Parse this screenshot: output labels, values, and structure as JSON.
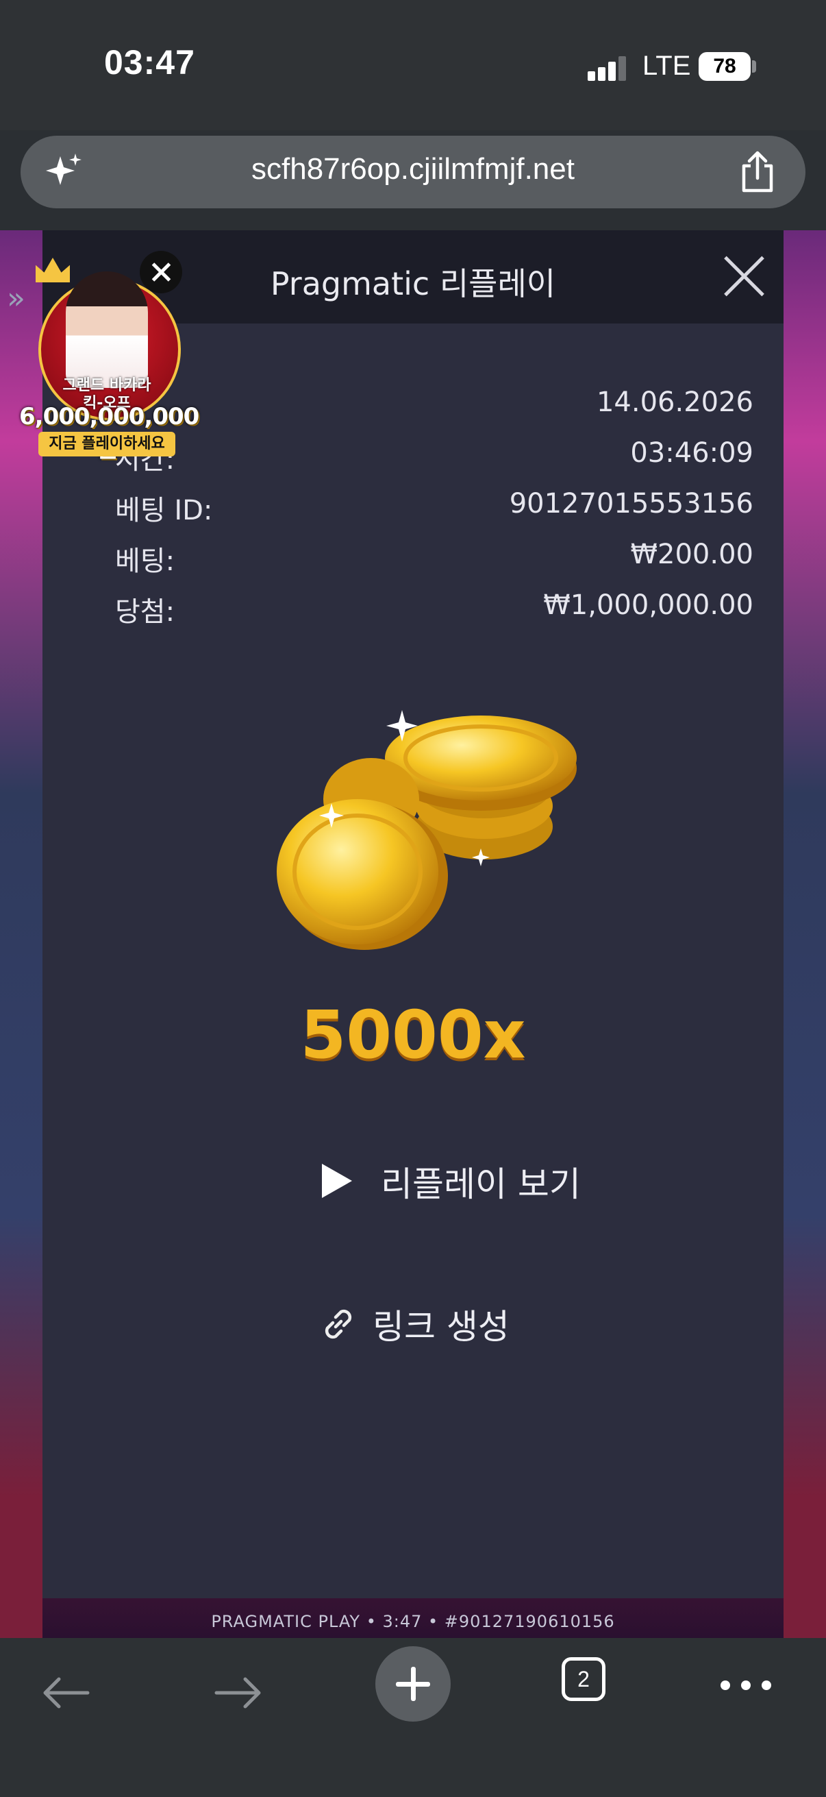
{
  "status_bar": {
    "time": "03:47",
    "network": "LTE",
    "battery": "78"
  },
  "browser": {
    "url": "scfh87r6op.cjiilmfmjf.net",
    "tab_count": "2"
  },
  "game": {
    "footer": "PRAGMATIC PLAY • 3:47 • #90127190610156"
  },
  "ad": {
    "line1": "그랜드 바카라",
    "line2": "킥-오프",
    "amount": "6,000,000,000원",
    "cta": "지금 플레이하세요"
  },
  "modal": {
    "title": "Pragmatic 리플레이",
    "rows": [
      {
        "label": "",
        "value": "14.06.2026"
      },
      {
        "label": "시간:",
        "value": "03:46:09"
      },
      {
        "label": "베팅 ID:",
        "value": "90127015553156"
      },
      {
        "label": "베팅:",
        "value": "₩200.00"
      },
      {
        "label": "당첨:",
        "value": "₩1,000,000.00"
      }
    ],
    "multiplier": "5000x",
    "replay_label": "리플레이 보기",
    "link_label": "링크 생성"
  },
  "colors": {
    "accent_gold": "#f3b622",
    "modal_bg": "#2c2d3e",
    "modal_header": "#1c1d28"
  }
}
